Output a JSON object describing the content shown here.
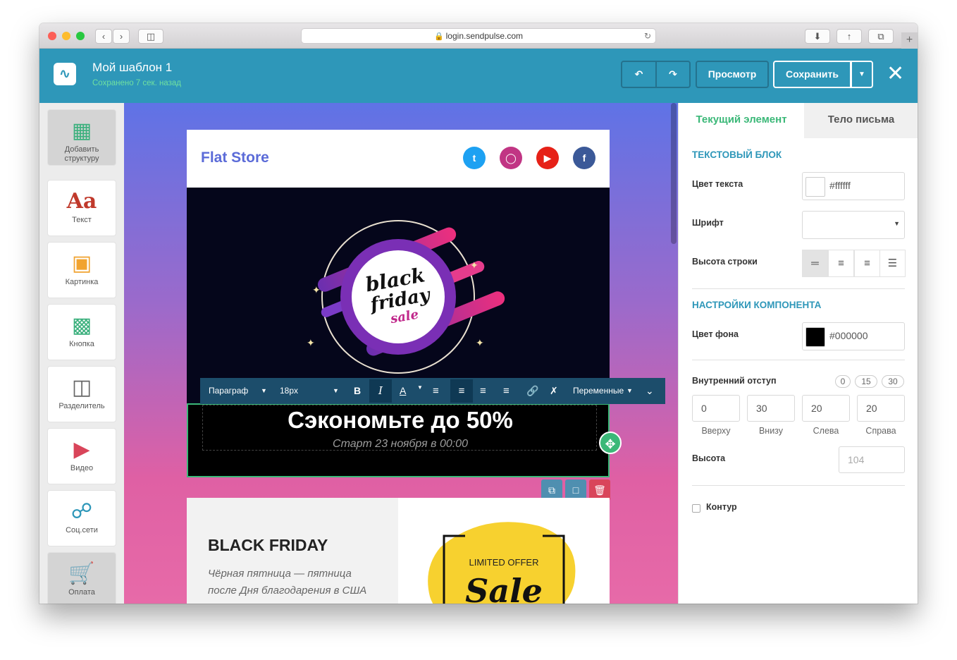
{
  "browser": {
    "url": "login.sendpulse.com"
  },
  "header": {
    "title": "Мой шаблон 1",
    "saved_status": "Сохранено 7 сек. назад",
    "preview_label": "Просмотр",
    "save_label": "Сохранить"
  },
  "sidebar": {
    "items": [
      {
        "label": "Добавить структуру",
        "icon": "grid-icon"
      },
      {
        "label": "Текст",
        "icon": "text-icon"
      },
      {
        "label": "Картинка",
        "icon": "image-icon"
      },
      {
        "label": "Кнопка",
        "icon": "button-icon"
      },
      {
        "label": "Разделитель",
        "icon": "divider-icon"
      },
      {
        "label": "Видео",
        "icon": "video-icon"
      },
      {
        "label": "Соц.сети",
        "icon": "share-icon"
      },
      {
        "label": "Оплата",
        "icon": "cart-icon"
      }
    ]
  },
  "email": {
    "brand": "Flat Store",
    "hero_lines": [
      "black",
      "friday",
      "sale"
    ],
    "headline": "Сэкономьте до 50%",
    "subline": "Старт 23 ноября в 00:00",
    "section_title": "BLACK FRIDAY",
    "section_text": "Чёрная пятница — пятница после Дня благодарения в США",
    "offer_top": "LIMITED OFFER",
    "offer_big": "Sale"
  },
  "toolbar": {
    "paragraph": "Параграф",
    "font_size": "18px",
    "variables": "Переменные"
  },
  "panel": {
    "tab_current": "Текущий элемент",
    "tab_body": "Тело письма",
    "section_text_block": "ТЕКСТОВЫЙ БЛОК",
    "text_color_label": "Цвет текста",
    "text_color_value": "#ffffff",
    "font_label": "Шрифт",
    "line_height_label": "Высота строки",
    "section_component": "НАСТРОЙКИ КОМПОНЕНТА",
    "bg_color_label": "Цвет фона",
    "bg_color_value": "#000000",
    "padding_label": "Внутренний отступ",
    "padding_presets": [
      "0",
      "15",
      "30"
    ],
    "padding": {
      "top": "0",
      "bottom": "30",
      "left": "20",
      "right": "20"
    },
    "padding_labels": {
      "top": "Вверху",
      "bottom": "Внизу",
      "left": "Слева",
      "right": "Справа"
    },
    "height_label": "Высота",
    "height_placeholder": "104",
    "border_label": "Контур"
  },
  "colors": {
    "accent": "#2e97b9",
    "success": "#3bb878",
    "toolbar": "#1c4d6b"
  }
}
